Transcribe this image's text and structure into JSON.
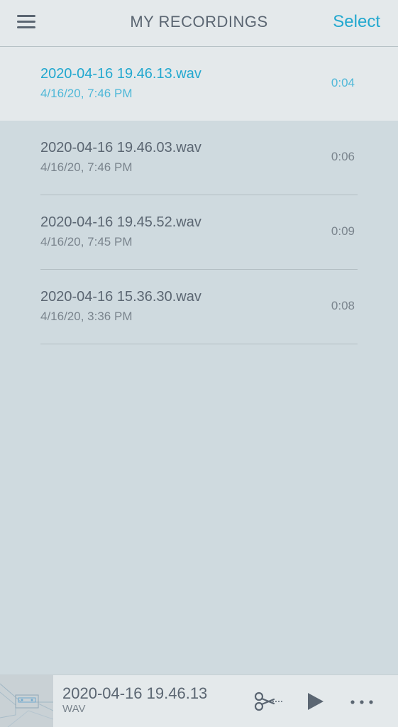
{
  "header": {
    "title": "MY RECORDINGS",
    "select_label": "Select",
    "menu_icon": "hamburger-menu-icon"
  },
  "recordings": [
    {
      "name": "2020-04-16 19.46.13.wav",
      "date": "4/16/20, 7:46 PM",
      "duration": "0:04",
      "selected": true
    },
    {
      "name": "2020-04-16 19.46.03.wav",
      "date": "4/16/20, 7:46 PM",
      "duration": "0:06",
      "selected": false
    },
    {
      "name": "2020-04-16 19.45.52.wav",
      "date": "4/16/20, 7:45 PM",
      "duration": "0:09",
      "selected": false
    },
    {
      "name": "2020-04-16 15.36.30.wav",
      "date": "4/16/20, 3:36 PM",
      "duration": "0:08",
      "selected": false
    }
  ],
  "player": {
    "title": "2020-04-16 19.46.13",
    "format": "WAV",
    "icons": [
      "cassette-thumbnail-icon",
      "scissors-icon",
      "play-icon",
      "more-dots-icon"
    ]
  },
  "colors": {
    "accent": "#22a8cf",
    "text": "#5b6672",
    "subtext": "#7a848d",
    "header_bg": "#e4e9eb",
    "list_bg": "#cfdadf"
  }
}
